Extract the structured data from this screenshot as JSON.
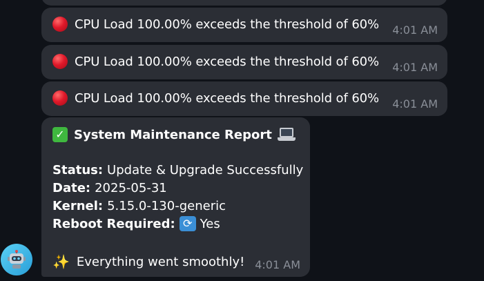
{
  "messages": {
    "alerts": [
      {
        "icon": "red-circle-icon",
        "text": "CPU Load 100.00% exceeds the threshold of 60%",
        "time": "4:01 AM"
      },
      {
        "icon": "red-circle-icon",
        "text": "CPU Load 100.00% exceeds the threshold of 60%",
        "time": "4:01 AM"
      },
      {
        "icon": "red-circle-icon",
        "text": "CPU Load 100.00% exceeds the threshold of 60%",
        "time": "4:01 AM"
      }
    ],
    "report": {
      "title_icon": "check-mark-icon",
      "title": "System Maintenance Report",
      "title_suffix_icon": "laptop-icon",
      "status_label": "Status:",
      "status_value": "Update & Upgrade Successfully",
      "date_label": "Date:",
      "date_value": "2025-05-31",
      "kernel_label": "Kernel:",
      "kernel_value": "5.15.0-130-generic",
      "reboot_label": "Reboot Required:",
      "reboot_icon": "repeat-icon",
      "reboot_value": "Yes",
      "footer_icon": "sparkles-icon",
      "footer": "Everything went smoothly!",
      "time": "4:01 AM"
    }
  },
  "sender": {
    "avatar_icon": "robot-icon"
  },
  "colors": {
    "background": "#0f1218",
    "bubble": "#2b2e35",
    "timestamp": "#8a8f98",
    "alert_dot": "#e0192a",
    "check": "#3fb83f",
    "avatar": "#2a9fd8"
  }
}
